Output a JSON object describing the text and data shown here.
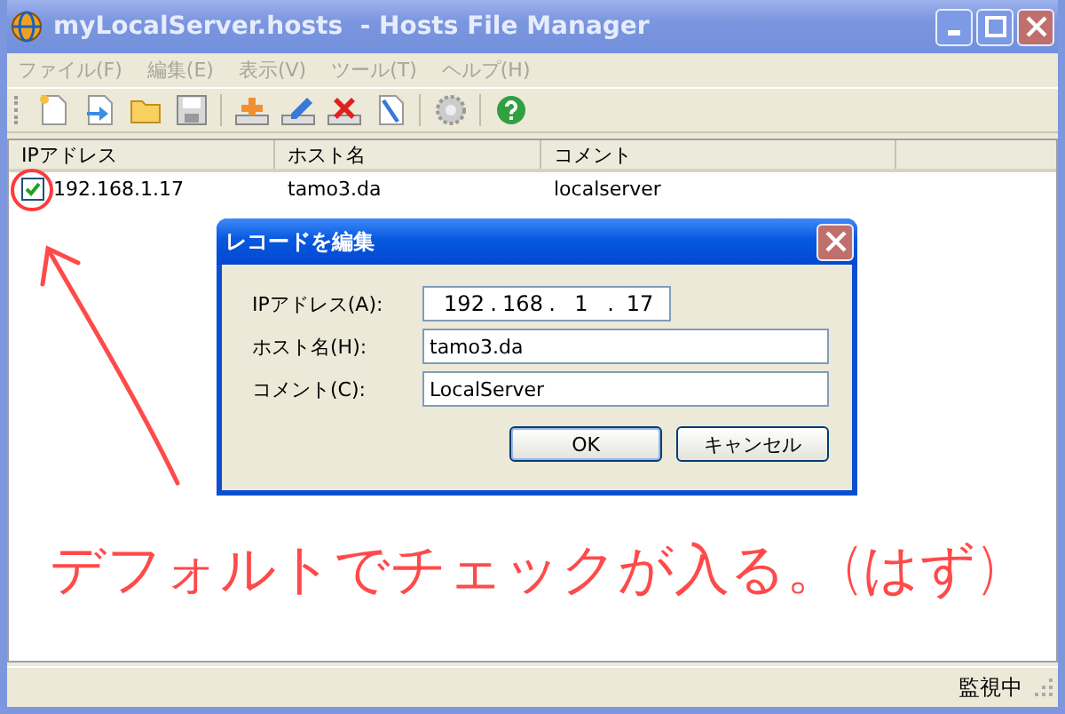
{
  "window": {
    "title": "myLocalServer.hosts  - Hosts File Manager"
  },
  "menu": [
    {
      "label": "ファイル(F)",
      "disabled": true
    },
    {
      "label": "編集(E)",
      "disabled": true
    },
    {
      "label": "表示(V)",
      "disabled": true
    },
    {
      "label": "ツール(T)",
      "disabled": true
    },
    {
      "label": "ヘルプ(H)",
      "disabled": true
    }
  ],
  "list": {
    "columns": [
      "IPアドレス",
      "ホスト名",
      "コメント"
    ],
    "rows": [
      {
        "checked": true,
        "cells": [
          "192.168.1.17",
          "tamo3.da",
          "localserver"
        ]
      }
    ]
  },
  "dialog": {
    "title": "レコードを編集",
    "fields": [
      {
        "kind": "ip",
        "label": "IPアドレス(A):",
        "octets": [
          "192",
          "168",
          "1",
          "17"
        ],
        "separator": "."
      },
      {
        "kind": "text",
        "label": "ホスト名(H):",
        "value": "tamo3.da"
      },
      {
        "kind": "text",
        "label": "コメント(C):",
        "value": "LocalServer"
      }
    ],
    "buttons": [
      "OK",
      "キャンセル"
    ]
  },
  "annotation": {
    "text": "デフォルトでチェックが入る。(はず)"
  },
  "status_bar": {
    "text": "監視中"
  }
}
